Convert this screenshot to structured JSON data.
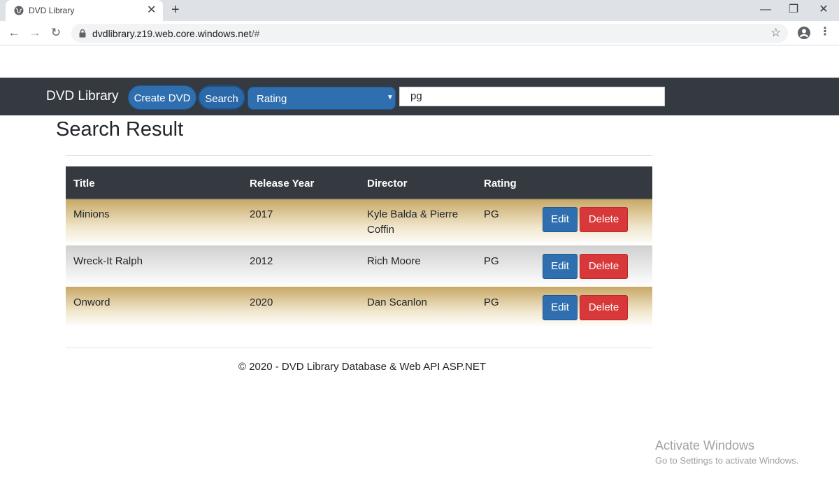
{
  "browser": {
    "tab_title": "DVD Library",
    "tab_close": "✕",
    "new_tab": "+",
    "url_host": "dvdlibrary.z19.web.core.windows.net",
    "url_path": "/#"
  },
  "navbar": {
    "brand": "DVD Library",
    "create_label": "Create DVD",
    "search_label": "Search",
    "category_selected": "Rating",
    "search_value": "pg"
  },
  "page": {
    "title": "Search Result"
  },
  "table": {
    "headers": [
      "Title",
      "Release Year",
      "Director",
      "Rating"
    ],
    "rows": [
      {
        "title": "Minions",
        "year": "2017",
        "director": "Kyle Balda & Pierre Coffin",
        "rating": "PG",
        "edit": "Edit",
        "delete": "Delete"
      },
      {
        "title": "Wreck-It Ralph",
        "year": "2012",
        "director": "Rich Moore",
        "rating": "PG",
        "edit": "Edit",
        "delete": "Delete"
      },
      {
        "title": "Onword",
        "year": "2020",
        "director": "Dan Scanlon",
        "rating": "PG",
        "edit": "Edit",
        "delete": "Delete"
      }
    ]
  },
  "footer": {
    "text": "© 2020 - DVD Library Database & Web API ASP.NET"
  },
  "watermark": {
    "title": "Activate Windows",
    "subtitle": "Go to Settings to activate Windows."
  },
  "colors": {
    "navbar": "#343a40",
    "primary": "#2f6fb0",
    "danger": "#d9383a",
    "row_gold": "#c8a866",
    "row_gray": "#d0d0d0"
  }
}
